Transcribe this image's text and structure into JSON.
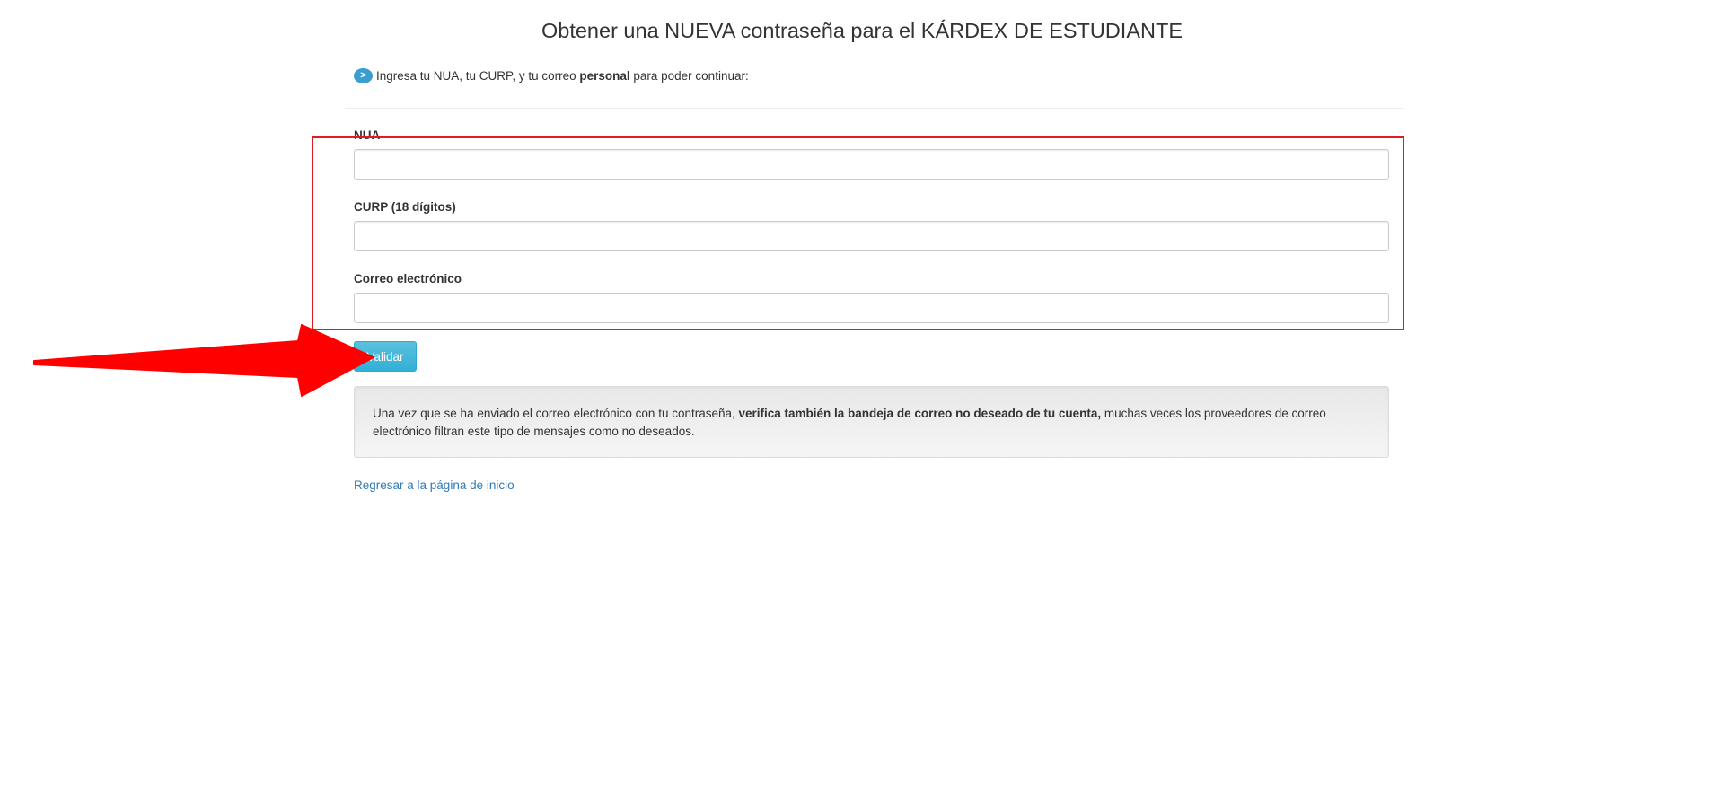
{
  "page": {
    "title": "Obtener una NUEVA contraseña para el KÁRDEX DE ESTUDIANTE"
  },
  "instruction": {
    "icon": "chevron-right-icon",
    "icon_glyph": ">",
    "text_before": "Ingresa tu NUA, tu CURP, y tu correo ",
    "text_bold": "personal",
    "text_after": " para poder continuar:"
  },
  "form": {
    "fields": [
      {
        "label": "NUA",
        "value": ""
      },
      {
        "label": "CURP (18 dígitos)",
        "value": ""
      },
      {
        "label": "Correo electrónico",
        "value": ""
      }
    ],
    "submit_label": "Validar"
  },
  "notice": {
    "text_before": "Una vez que se ha enviado el correo electrónico con tu contraseña, ",
    "text_bold": "verifica también la bandeja de correo no deseado de tu cuenta,",
    "text_after": " muchas veces los proveedores de correo electrónico filtran este tipo de mensajes como no deseados."
  },
  "links": {
    "home": "Regresar a la página de inicio"
  },
  "annotation": {
    "color": "#e01b24",
    "arrow_color": "#ff0000"
  }
}
